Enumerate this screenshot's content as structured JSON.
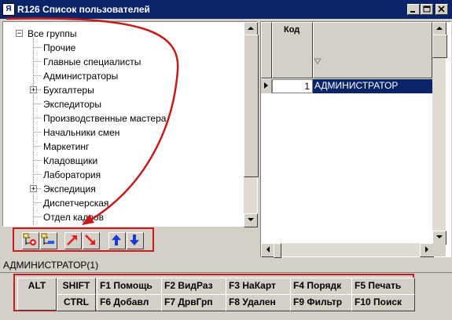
{
  "window": {
    "title": "R126 Список пользователей",
    "icon": "app-icon",
    "icon_text": "Я",
    "controls": [
      "minimize",
      "maximize",
      "close"
    ]
  },
  "tree": {
    "items": [
      {
        "label": "Все группы",
        "expander": "−"
      },
      {
        "label": "Прочие"
      },
      {
        "label": "Главные специалисты"
      },
      {
        "label": "Администраторы"
      },
      {
        "label": "Бухгалтеры",
        "expander": "+"
      },
      {
        "label": "Экспедиторы"
      },
      {
        "label": "Производственные мастера"
      },
      {
        "label": "Начальники смен"
      },
      {
        "label": "Маркетинг"
      },
      {
        "label": "Кладовщики"
      },
      {
        "label": "Лаборатория"
      },
      {
        "label": "Экспедиция",
        "expander": "+"
      },
      {
        "label": "Диспетчерская"
      },
      {
        "label": "Отдел кадров"
      }
    ]
  },
  "toolbar": {
    "buttons": [
      {
        "name": "add-group-icon"
      },
      {
        "name": "remove-group-icon"
      },
      {
        "name": "arrow-up-right-icon"
      },
      {
        "name": "arrow-down-right-icon"
      },
      {
        "name": "arrow-up-icon"
      },
      {
        "name": "arrow-down-icon"
      }
    ]
  },
  "grid": {
    "column_code": "Код",
    "rows": [
      {
        "code": "1",
        "name": "АДМИНИСТРАТОР",
        "selected": true
      }
    ]
  },
  "status": {
    "text": "АДМИНИСТРАТОР(1)"
  },
  "keys": {
    "alt": "ALT",
    "shift": "SHIFT",
    "ctrl": "CTRL",
    "f1": {
      "key": "F1",
      "label": "Помощь"
    },
    "f2": {
      "key": "F2",
      "label": "ВидРаз"
    },
    "f3": {
      "key": "F3",
      "label": "НаКарт"
    },
    "f4": {
      "key": "F4",
      "label": "Порядк"
    },
    "f5": {
      "key": "F5",
      "label": "Печать"
    },
    "f6": {
      "key": "F6",
      "label": "Добавл"
    },
    "f7": {
      "key": "F7",
      "label": "ДрвГрп"
    },
    "f8": {
      "key": "F8",
      "label": "Удален"
    },
    "f9": {
      "key": "F9",
      "label": "Фильтр"
    },
    "f10": {
      "key": "F10",
      "label": "Поиск"
    }
  },
  "colors": {
    "titlebar": "#0a246a",
    "selection": "#0a246a",
    "annotation": "#c41c1c"
  }
}
